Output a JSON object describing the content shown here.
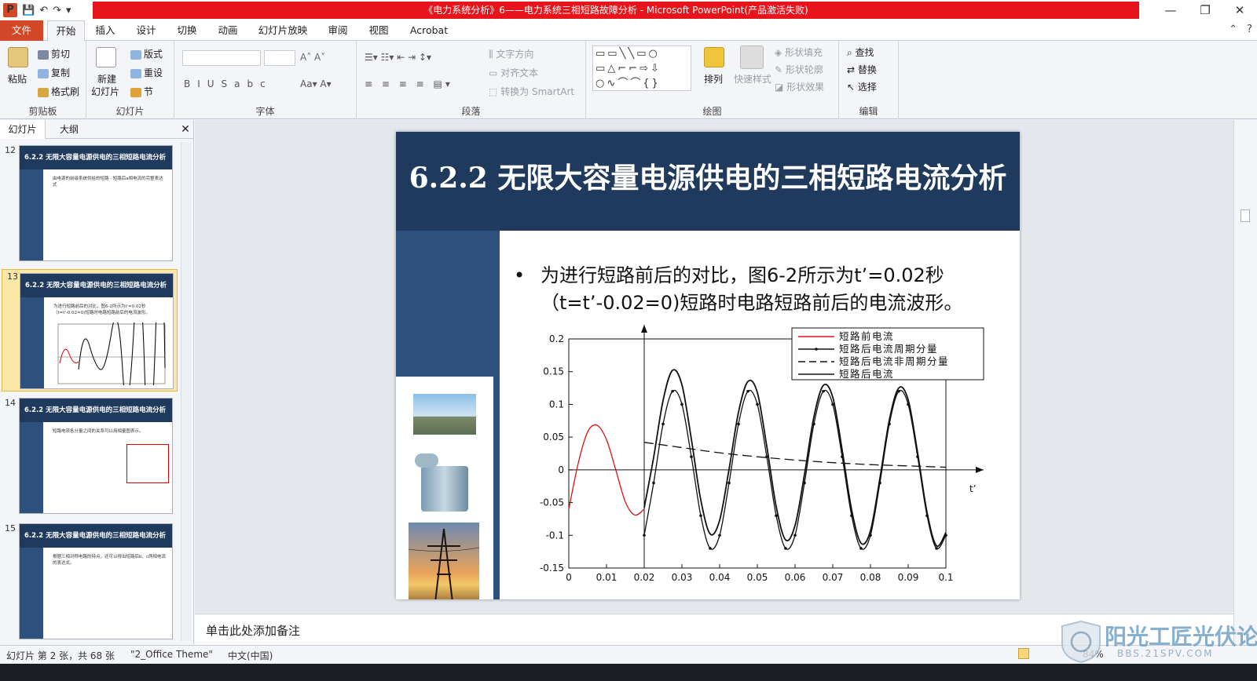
{
  "window": {
    "title": "《电力系统分析》6——电力系统三相短路故障分析 - Microsoft PowerPoint(产品激活失败)",
    "app_icon": "P"
  },
  "tabs": [
    {
      "label": "文件"
    },
    {
      "label": "开始"
    },
    {
      "label": "插入"
    },
    {
      "label": "设计"
    },
    {
      "label": "切换"
    },
    {
      "label": "动画"
    },
    {
      "label": "幻灯片放映"
    },
    {
      "label": "审阅"
    },
    {
      "label": "视图"
    },
    {
      "label": "Acrobat"
    }
  ],
  "ribbon": {
    "clipboard": {
      "label": "剪贴板",
      "paste": "粘贴",
      "cut": "剪切",
      "copy": "复制",
      "format_painter": "格式刷"
    },
    "slides": {
      "label": "幻灯片",
      "new_slide_1": "新建",
      "new_slide_2": "幻灯片",
      "layout": "版式",
      "reset": "重设",
      "section": "节"
    },
    "font": {
      "label": "字体"
    },
    "paragraph": {
      "label": "段落",
      "text_direction": "文字方向",
      "align_text": "对齐文本",
      "smartart": "转换为 SmartArt"
    },
    "drawing": {
      "label": "绘图",
      "arrange": "排列",
      "quick_styles": "快速样式",
      "shape_fill": "形状填充",
      "shape_outline": "形状轮廓",
      "shape_effects": "形状效果"
    },
    "editing": {
      "label": "编辑",
      "find": "查找",
      "replace": "替换",
      "select": "选择"
    }
  },
  "left_pane": {
    "tab_slides": "幻灯片",
    "tab_outline": "大纲",
    "thumbnails": [
      {
        "num": "12",
        "title": "6.2.2 无限大容量电源供电的三相短路电流分析",
        "body": "由电源的前级系统供给的短路 · 短路后a相电流的完整表达式"
      },
      {
        "num": "13",
        "title": "6.2.2 无限大容量电源供电的三相短路电流分析",
        "body": "为进行短路前后的对比，图6-2所示为t'=0.02秒（t=t'-0.02=0)短路时电路短路前后的电流波形。"
      },
      {
        "num": "14",
        "title": "6.2.2 无限大容量电源供电的三相短路电流分析",
        "body": "短路电流各分量之间的关系可以用相量图表示。"
      },
      {
        "num": "15",
        "title": "6.2.2 无限大容量电源供电的三相短路电流分析",
        "body": "根据三相对称电路的特点，还可以得出短路后b、c两相电流的表达式。"
      }
    ]
  },
  "slide": {
    "title": "6.2.2 无限大容量电源供电的三相短路电流分析",
    "bullet": "为进行短路前后的对比，图6-2所示为t’=0.02秒（t=t’-0.02=0)短路时电路短路前后的电流波形。"
  },
  "chart_data": {
    "type": "line",
    "xlabel": "t’",
    "ylabel": "",
    "xlim": [
      0,
      0.1
    ],
    "ylim": [
      -0.15,
      0.2
    ],
    "x_ticks": [
      "0",
      "0.01",
      "0.02",
      "0.03",
      "0.04",
      "0.05",
      "0.06",
      "0.07",
      "0.08",
      "0.09",
      "0.1"
    ],
    "y_ticks": [
      "0.2",
      "0.15",
      "0.1",
      "0.05",
      "0",
      "-0.05",
      "-0.1",
      "-0.15"
    ],
    "legend_position": "top-right",
    "series": [
      {
        "name": "短路前电流",
        "color": "#e01010",
        "style": "solid",
        "x": [
          0,
          0.0025,
          0.005,
          0.0075,
          0.01,
          0.0125,
          0.015,
          0.0175,
          0.02
        ],
        "y": [
          -0.06,
          0.01,
          0.058,
          0.068,
          0.046,
          -0.001,
          -0.049,
          -0.069,
          -0.06
        ]
      },
      {
        "name": "短路后电流周期分量",
        "color": "#111111",
        "style": "solid-markers",
        "x": [
          0.02,
          0.0225,
          0.025,
          0.0275,
          0.03,
          0.0325,
          0.035,
          0.0375,
          0.04,
          0.0425,
          0.045,
          0.0475,
          0.05,
          0.0525,
          0.055,
          0.0575,
          0.06,
          0.0625,
          0.065,
          0.0675,
          0.07,
          0.0725,
          0.075,
          0.0775,
          0.08,
          0.0825,
          0.085,
          0.0875,
          0.09,
          0.0925,
          0.095,
          0.0975,
          0.1
        ],
        "y": [
          -0.1,
          -0.02,
          0.07,
          0.12,
          0.1,
          0.02,
          -0.07,
          -0.12,
          -0.1,
          -0.02,
          0.07,
          0.12,
          0.1,
          0.02,
          -0.07,
          -0.12,
          -0.1,
          -0.02,
          0.07,
          0.12,
          0.1,
          0.02,
          -0.07,
          -0.12,
          -0.1,
          -0.02,
          0.07,
          0.12,
          0.1,
          0.02,
          -0.07,
          -0.12,
          -0.1
        ]
      },
      {
        "name": "短路后电流非周期分量",
        "color": "#111111",
        "style": "dashed",
        "x": [
          0.02,
          0.03,
          0.04,
          0.05,
          0.06,
          0.07,
          0.08,
          0.09,
          0.1
        ],
        "y": [
          0.042,
          0.034,
          0.026,
          0.02,
          0.015,
          0.011,
          0.008,
          0.006,
          0.004
        ]
      },
      {
        "name": "短路后电流",
        "color": "#111111",
        "style": "solid",
        "x": [
          0.02,
          0.0225,
          0.025,
          0.0275,
          0.03,
          0.0325,
          0.035,
          0.0375,
          0.04,
          0.0425,
          0.045,
          0.0475,
          0.05,
          0.0525,
          0.055,
          0.0575,
          0.06,
          0.0625,
          0.065,
          0.0675,
          0.07,
          0.0725,
          0.075,
          0.0775,
          0.08,
          0.0825,
          0.085,
          0.0875,
          0.09,
          0.0925,
          0.095,
          0.0975,
          0.1
        ],
        "y": [
          -0.058,
          0.019,
          0.106,
          0.152,
          0.13,
          0.047,
          -0.046,
          -0.098,
          -0.077,
          0.001,
          0.088,
          0.135,
          0.118,
          0.036,
          -0.056,
          -0.107,
          -0.085,
          -0.007,
          0.081,
          0.129,
          0.111,
          0.03,
          -0.061,
          -0.112,
          -0.093,
          -0.013,
          0.076,
          0.125,
          0.107,
          0.026,
          -0.065,
          -0.116,
          -0.096
        ]
      }
    ]
  },
  "notes": {
    "placeholder": "单击此处添加备注"
  },
  "status": {
    "slide_info": "幻灯片 第 2 张，共 68 张",
    "theme": "\"2_Office Theme\"",
    "language": "中文(中国)",
    "zoom": "84%"
  },
  "watermark": {
    "name": "阳光工匠光伏论坛",
    "url": "BBS.21SPV.COM"
  },
  "colors": {
    "title_bar_red": "#e8141c",
    "file_tab": "#d24726",
    "slide_header": "#1f3a5c",
    "slide_side": "#2e507c"
  }
}
